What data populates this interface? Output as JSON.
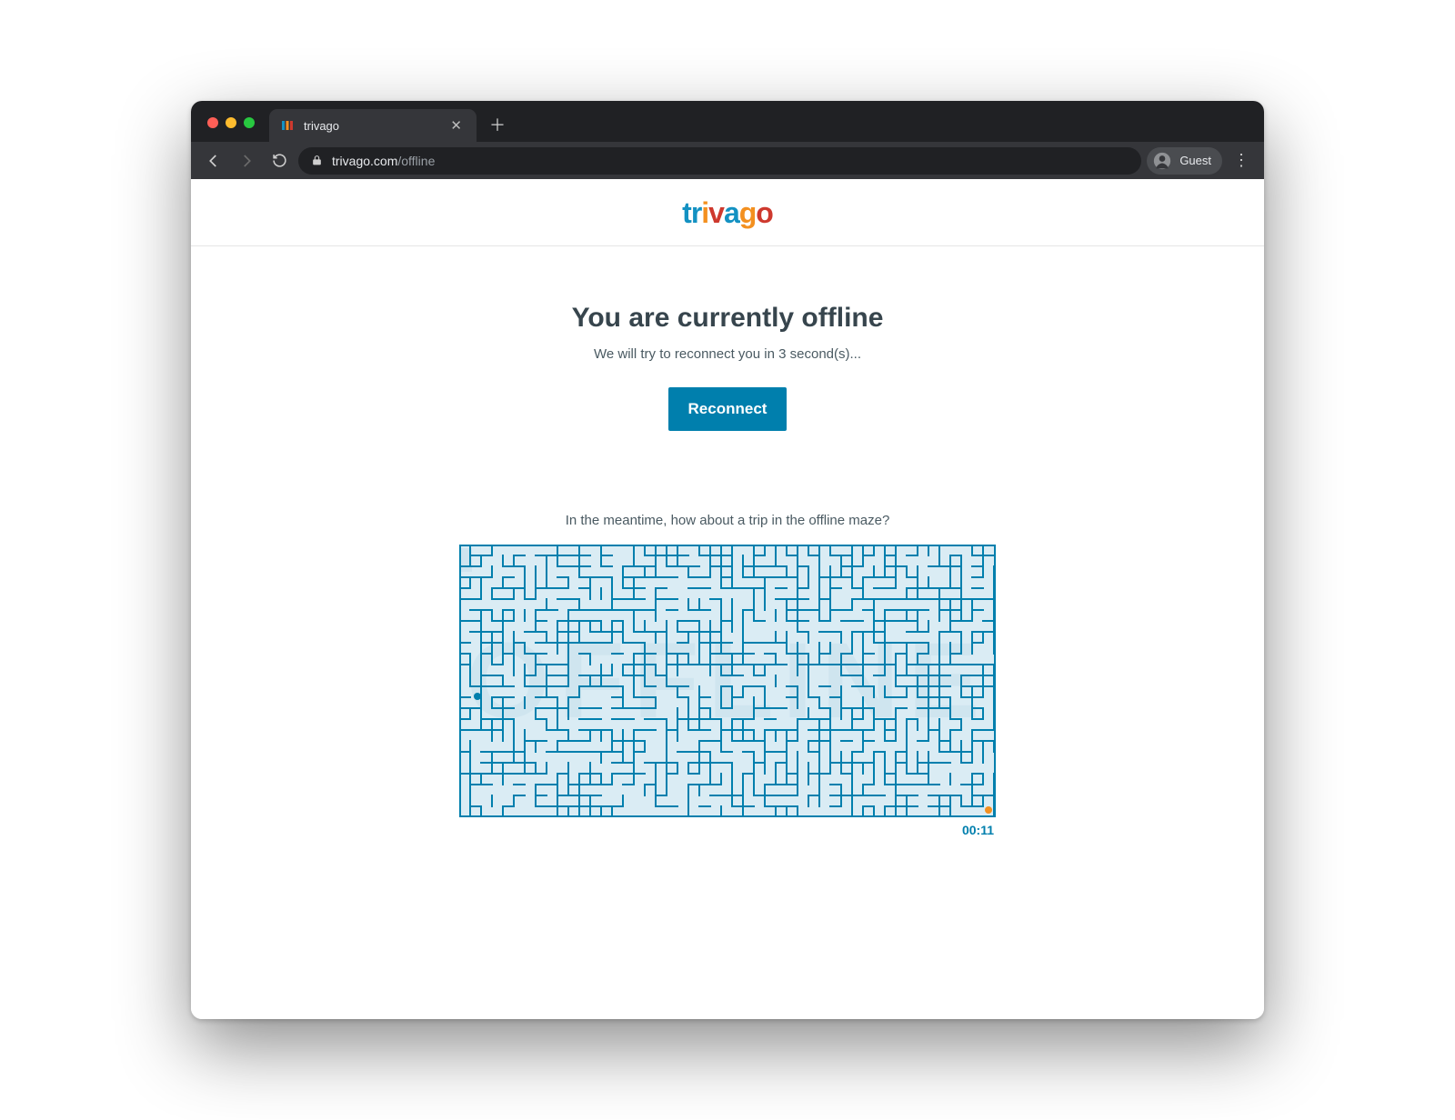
{
  "browser": {
    "tab_title": "trivago",
    "url_host": "trivago.com",
    "url_path": "/offline",
    "guest_label": "Guest"
  },
  "logo": {
    "text": "trivago",
    "letters": [
      "t",
      "r",
      "i",
      "v",
      "a",
      "g",
      "o"
    ]
  },
  "offline": {
    "heading": "You are currently offline",
    "subline": "We will try to reconnect you in 3 second(s)...",
    "reconnect_label": "Reconnect",
    "maze_lead": "In the meantime, how about a trip in the offline maze?",
    "maze_word": "OFFLINE",
    "timer": "00:11"
  },
  "colors": {
    "brand_blue": "#007fad",
    "brand_orange": "#f39020",
    "brand_red": "#ce392e",
    "maze_bg": "#daecf4"
  }
}
